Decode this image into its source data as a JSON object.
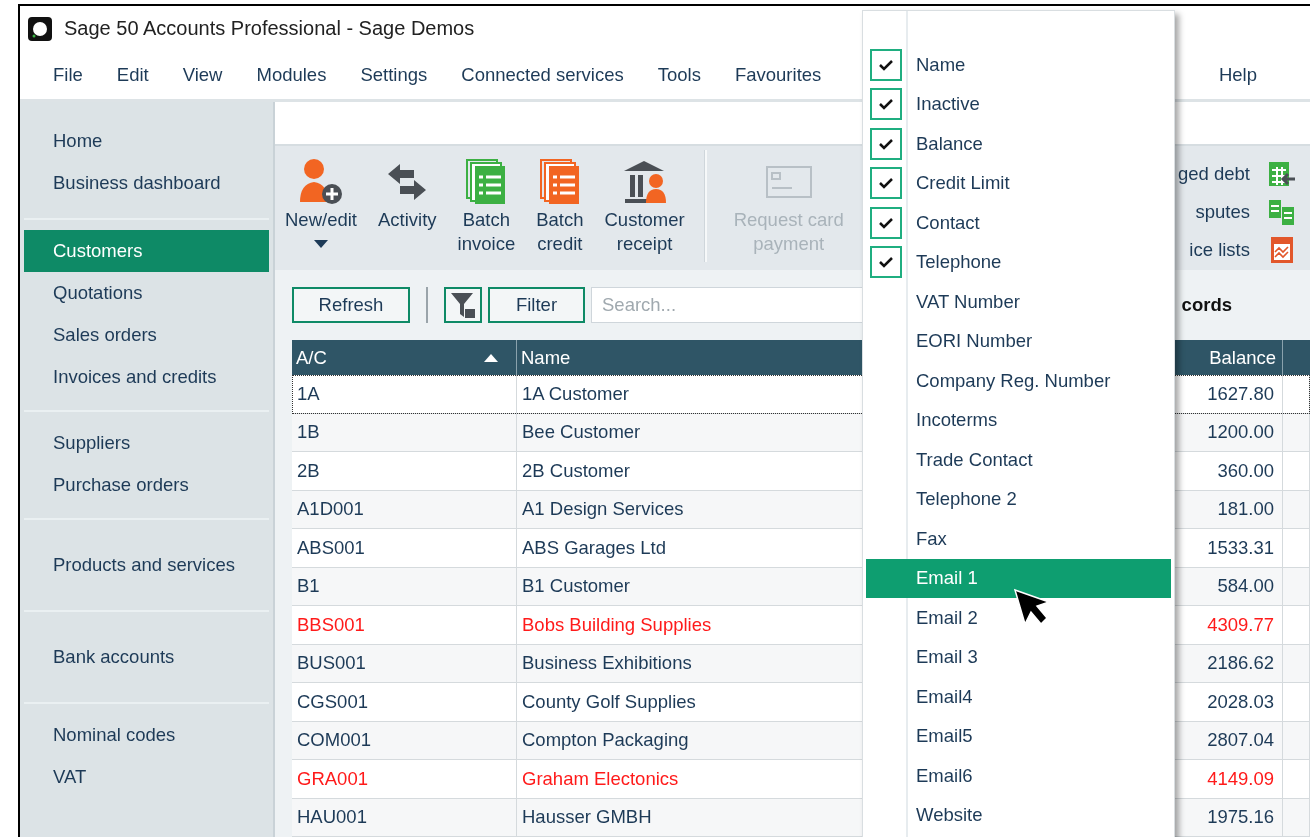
{
  "window": {
    "title": "Sage 50 Accounts Professional - Sage Demos"
  },
  "menu_bar": [
    "File",
    "Edit",
    "View",
    "Modules",
    "Settings",
    "Connected services",
    "Tools",
    "Favourites",
    "Help"
  ],
  "sidebar": {
    "groups": [
      [
        {
          "label": "Home",
          "selected": false
        },
        {
          "label": "Business dashboard",
          "selected": false
        }
      ],
      [
        {
          "label": "Customers",
          "selected": true
        },
        {
          "label": "Quotations",
          "selected": false
        },
        {
          "label": "Sales orders",
          "selected": false
        },
        {
          "label": "Invoices and credits",
          "selected": false
        }
      ],
      [
        {
          "label": "Suppliers",
          "selected": false
        },
        {
          "label": "Purchase orders",
          "selected": false
        }
      ],
      [
        {
          "label": "Products and services",
          "selected": false
        }
      ],
      [
        {
          "label": "Bank accounts",
          "selected": false
        }
      ],
      [
        {
          "label": "Nominal codes",
          "selected": false
        },
        {
          "label": "VAT",
          "selected": false
        }
      ]
    ]
  },
  "toolbar": {
    "buttons": [
      {
        "label": "New/edit",
        "kind": "new",
        "dropdown": true,
        "disabled": false
      },
      {
        "label": "Activity",
        "kind": "activity",
        "dropdown": false,
        "disabled": false
      },
      {
        "label": "Batch invoice",
        "kind": "batch_invoice",
        "dropdown": false,
        "disabled": false
      },
      {
        "label": "Batch credit",
        "kind": "batch_credit",
        "dropdown": false,
        "disabled": false
      },
      {
        "label": "Customer receipt",
        "kind": "receipt",
        "dropdown": false,
        "disabled": false
      },
      {
        "label": "Request card payment",
        "kind": "card",
        "dropdown": false,
        "disabled": true
      }
    ],
    "links": [
      {
        "label": "ged debt",
        "kind": "grid"
      },
      {
        "label": "sputes",
        "kind": "docs"
      },
      {
        "label": "ice lists",
        "kind": "chart"
      }
    ]
  },
  "filter_bar": {
    "refresh": "Refresh",
    "filter": "Filter",
    "search": {
      "placeholder": "Search..."
    },
    "records": "cords"
  },
  "table": {
    "columns": [
      {
        "label": "A/C",
        "sorted": true
      },
      {
        "label": "Name",
        "sorted": false
      },
      {
        "label": "Balance",
        "sorted": false
      }
    ],
    "rows": [
      {
        "cells": [
          "1A",
          "1A Customer",
          "1627.80"
        ],
        "selected": true,
        "alert": false
      },
      {
        "cells": [
          "1B",
          "Bee Customer",
          "1200.00"
        ],
        "selected": false,
        "alert": false
      },
      {
        "cells": [
          "2B",
          "2B Customer",
          "360.00"
        ],
        "selected": false,
        "alert": false
      },
      {
        "cells": [
          "A1D001",
          "A1 Design Services",
          "181.00"
        ],
        "selected": false,
        "alert": false
      },
      {
        "cells": [
          "ABS001",
          "ABS Garages Ltd",
          "1533.31"
        ],
        "selected": false,
        "alert": false
      },
      {
        "cells": [
          "B1",
          "B1 Customer",
          "584.00"
        ],
        "selected": false,
        "alert": false
      },
      {
        "cells": [
          "BBS001",
          "Bobs Building Supplies",
          "4309.77"
        ],
        "selected": false,
        "alert": true
      },
      {
        "cells": [
          "BUS001",
          "Business Exhibitions",
          "2186.62"
        ],
        "selected": false,
        "alert": false
      },
      {
        "cells": [
          "CGS001",
          "County Golf Supplies",
          "2028.03"
        ],
        "selected": false,
        "alert": false
      },
      {
        "cells": [
          "COM001",
          "Compton Packaging",
          "2807.04"
        ],
        "selected": false,
        "alert": false
      },
      {
        "cells": [
          "GRA001",
          "Graham Electonics",
          "4149.09"
        ],
        "selected": false,
        "alert": true
      },
      {
        "cells": [
          "HAU001",
          "Hausser GMBH",
          "1975.16"
        ],
        "selected": false,
        "alert": false
      }
    ]
  },
  "column_menu": {
    "items": [
      {
        "label": "Name",
        "checked": true,
        "selected": false
      },
      {
        "label": "Inactive",
        "checked": true,
        "selected": false
      },
      {
        "label": "Balance",
        "checked": true,
        "selected": false
      },
      {
        "label": "Credit Limit",
        "checked": true,
        "selected": false
      },
      {
        "label": "Contact",
        "checked": true,
        "selected": false
      },
      {
        "label": "Telephone",
        "checked": true,
        "selected": false
      },
      {
        "label": "VAT Number",
        "checked": false,
        "selected": false
      },
      {
        "label": "EORI Number",
        "checked": false,
        "selected": false
      },
      {
        "label": "Company Reg. Number",
        "checked": false,
        "selected": false
      },
      {
        "label": "Incoterms",
        "checked": false,
        "selected": false
      },
      {
        "label": "Trade Contact",
        "checked": false,
        "selected": false
      },
      {
        "label": "Telephone 2",
        "checked": false,
        "selected": false
      },
      {
        "label": "Fax",
        "checked": false,
        "selected": false
      },
      {
        "label": "Email 1",
        "checked": false,
        "selected": true
      },
      {
        "label": "Email 2",
        "checked": false,
        "selected": false
      },
      {
        "label": "Email 3",
        "checked": false,
        "selected": false
      },
      {
        "label": "Email4",
        "checked": false,
        "selected": false
      },
      {
        "label": "Email5",
        "checked": false,
        "selected": false
      },
      {
        "label": "Email6",
        "checked": false,
        "selected": false
      },
      {
        "label": "Website",
        "checked": false,
        "selected": false
      }
    ]
  }
}
